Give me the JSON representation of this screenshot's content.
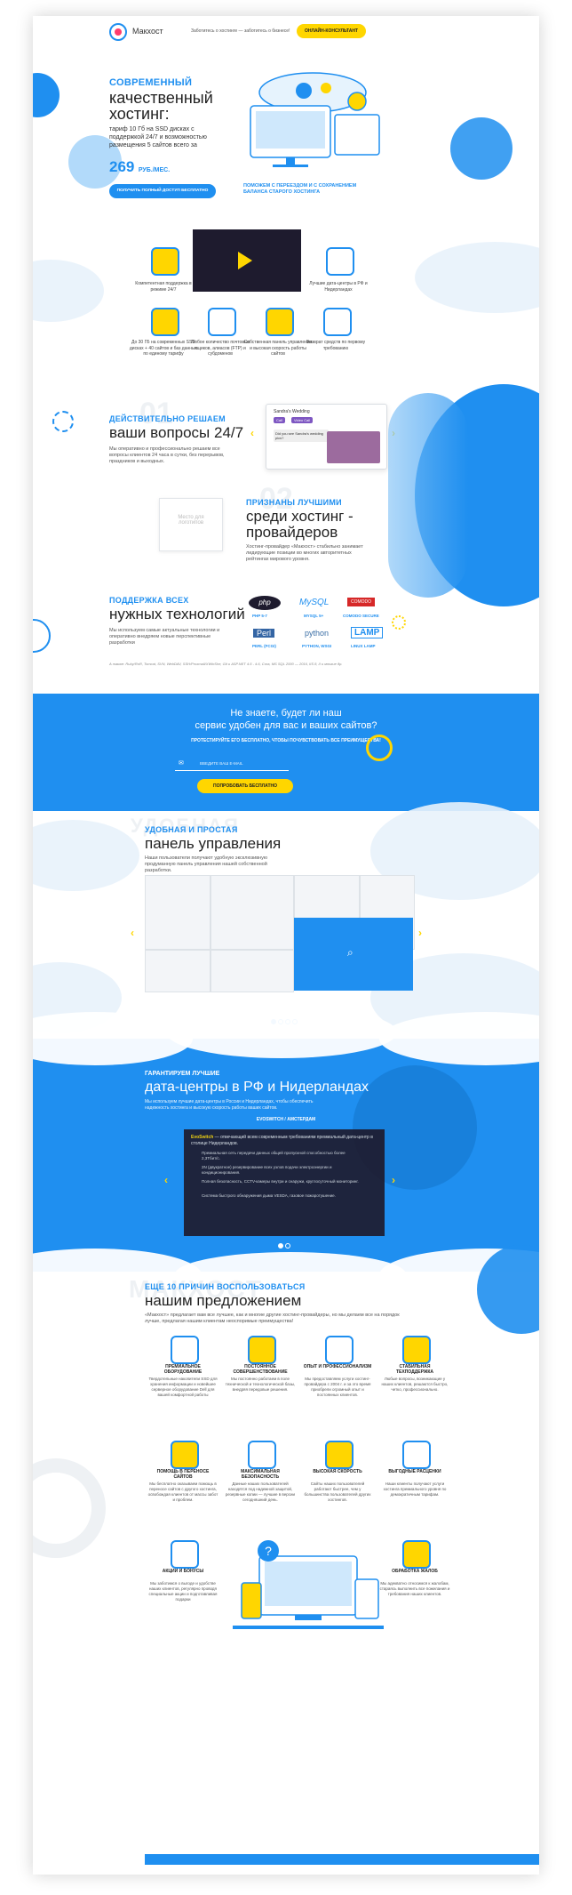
{
  "header": {
    "logo_text": "Макхост",
    "tagline": "Заботитесь о хостинге — заботитесь о бизнесе!",
    "consultant_button": "ОНЛАЙН-КОНСУЛЬТАНТ"
  },
  "hero": {
    "line1": "СОВРЕМЕННЫЙ",
    "line2": "качественный",
    "line3": "хостинг:",
    "desc": "тариф 10 Гб на SSD дисках с поддержкой 24/7 и возможностью размещения 5 сайтов всего за",
    "price": "269",
    "price_unit": "РУБ./МЕС.",
    "cta_button": "ПОЛУЧИТЬ ПОЛНЫЙ ДОСТУП БЕСПЛАТНО",
    "note": "ПОМОЖЕМ С ПЕРЕЕЗДОМ И С СОХРАНЕНИЕМ БАЛАНСА СТАРОГО ХОСТИНГА"
  },
  "features": [
    {
      "icon": "chat-support-icon",
      "text": "Компетентная поддержка в режиме 24/7"
    },
    {
      "icon": "datacenter-icon",
      "text": "Лучшие дата-центры в РФ и Нидерландах"
    },
    {
      "icon": "ssd-disk-icon",
      "text": "До 30 ГБ на современных SSD дисках + 40 сайтов и баз данных по единому тарифу"
    },
    {
      "icon": "mail-icon",
      "text": "Любое количество почтовых ящиков, алиасов (FTP) и субдоменов"
    },
    {
      "icon": "panel-icon",
      "text": "Собственная панель управления и высокая скорость работы сайтов"
    },
    {
      "icon": "money-back-icon",
      "text": "Возврат средств по первому требованию"
    }
  ],
  "solve": {
    "small": "ДЕЙСТВИТЕЛЬНО РЕШАЕМ",
    "big": "ваши вопросы 24/7",
    "bg_number": "01",
    "desc": "Мы оперативно и профессионально решаем все вопросы клиентов 24 часа в сутки, без перерывов, праздников и выходных.",
    "chat_name": "Sandra's Wedding",
    "chat_call": "Call",
    "chat_video": "Video Call",
    "chat_msg": "Did you see Sandra's wedding pics?"
  },
  "best": {
    "small": "ПРИЗНАНЫ ЛУЧШИМИ",
    "big1": "среди хостинг -",
    "big2": "провайдеров",
    "bg_number": "02",
    "logo_placeholder": "Место для логотипов",
    "desc": "Хостинг-провайдер «Макхост» стабильно занимает лидирующие позиции во многих авторитетных рейтингах мирового уровня."
  },
  "tech": {
    "small": "ПОДДЕРЖКА ВСЕХ",
    "big": "нужных технологий",
    "desc": "Мы используем самые актуальные технологии и оперативно внедряем новые перспективные разработки",
    "items": [
      {
        "logo": "php",
        "label": "PHP 5-7"
      },
      {
        "logo": "MySQL",
        "label": "MYSQL 5+"
      },
      {
        "logo": "COMODO",
        "label": "COMODO SECURE"
      },
      {
        "logo": "Perl",
        "label": "PERL (FCGI)"
      },
      {
        "logo": "python",
        "label": "PYTHON, WSGI"
      },
      {
        "logo": "LAMP",
        "label": "LINUX LAMP"
      }
    ],
    "footnote": "А также: Ruby/RoR, Tomcat, SVN, WebDAV, SSH/Proxmail/XWinShe, Git и ASP.NET 4.5 - 4.6, Cora, MS SQL 2000 — 2016, IIS 8, II и многие др."
  },
  "trial": {
    "title1": "Не знаете, будет ли наш",
    "title2": "сервис удобен для вас и ваших сайтов?",
    "subtitle": "ПРОТЕСТИРУЙТЕ ЕГО БЕСПЛАТНО, ЧТОБЫ ПОЧУВСТВОВАТЬ ВСЕ ПРЕИМУЩЕСТВА!",
    "email_placeholder": "ВВЕДИТЕ ВАШ E-MAIL",
    "button": "ПОПРОБОВАТЬ БЕСПЛАТНО"
  },
  "panel": {
    "bg_word": "УДОБНАЯ",
    "small": "УДОБНАЯ И ПРОСТАЯ",
    "big": "панель управления",
    "desc": "Наши пользователи получают удобную эксклюзивную продуманную панель управления нашей собственной разработки.",
    "dots": [
      "active",
      "",
      "",
      ""
    ]
  },
  "datacenters": {
    "small": "ГАРАНТИРУЕМ ЛУЧШИЕ",
    "big": "дата-центры в РФ и Нидерландах",
    "desc": "Мы используем лучшие дата-центры в России и Нидерландах, чтобы обеспечить надежность хостинга и высокую скорость работы ваших сайтов.",
    "tabs": "EVOSWITCH / АМСТЕРДАМ",
    "card_title": "EvoSwitch",
    "card_text": " — отвечающий всем современным требованиям премиальный дата-центр в столице Нидерландов.",
    "bullets": [
      "Премиальная сеть передачи данных общей пропускной способностью более 2,3Тбит/с.",
      "2N (двукратное) резервирование всех узлов подачи электроэнергии и кондиционирования.",
      "Полная безопасность, CCTV-камеры внутри и снаружи, круглосуточный мониторинг.",
      "Система быстрого обнаружения дыма VESDA, газовое пожаротушение."
    ]
  },
  "reasons": {
    "bg_word": "МАКХОСТ",
    "small": "ЕЩЕ 10 ПРИЧИН ВОСПОЛЬЗОВАТЬСЯ",
    "big": "нашим предложением",
    "desc": "«Макхост» предлагает вам все лучшее, как и многие другие хостинг-провайдеры, но мы делаем все на порядок лучше, предлагая нашим клиентам неоспоримые преимущества!",
    "items": [
      {
        "title": "ПРЕМИАЛЬНОЕ ОБОРУДОВАНИЕ",
        "text": "Твердотельные накопители SSD для хранения информации и новейшее серверное оборудование Dell для вашей комфортной работы",
        "icon": "server-icon"
      },
      {
        "title": "ПОСТОЯННОЕ СОВЕРШЕНСТВОВАНИЕ",
        "text": "Мы постоянно работаем в поле технической и технологической базы, внедряя передовые решения.",
        "icon": "gear-icon"
      },
      {
        "title": "ОПЫТ И ПРОФЕССИОНАЛИЗМ",
        "text": "Мы предоставляем услуги хостинг-провайдера с 2004 г. и за это время приобрели огромный опыт и постоянных клиентов.",
        "icon": "star-icon"
      },
      {
        "title": "СТАБИЛЬНАЯ ТЕХПОДДЕРЖКА",
        "text": "Любые вопросы, возникающие у наших клиентов, решаются быстро, четко, профессионально.",
        "icon": "wrench-icon"
      },
      {
        "title": "ПОМОЩЬ В ПЕРЕНОСЕ САЙТОВ",
        "text": "Мы бесплатно оказываем помощь в переносе сайтов с другого хостинга, освобождая клиентов от массы забот и проблем.",
        "icon": "transfer-icon"
      },
      {
        "title": "МАКСИМАЛЬНАЯ БЕЗОПАСНОСТЬ",
        "text": "Данные наших пользователей находятся под надежной защитой, резервные копии — лучшие в версии сегодняшний день.",
        "icon": "shield-icon"
      },
      {
        "title": "ВЫСОКАЯ СКОРОСТЬ",
        "text": "Сайты наших пользователей работают быстрее, чем у большинства пользователей других хостингов.",
        "icon": "speed-icon"
      },
      {
        "title": "ВЫГОДНЫЕ РАСЦЕНКИ",
        "text": "Наши клиенты получают услуги хостинга премиального уровня по демократичным тарифам.",
        "icon": "wallet-icon"
      },
      {
        "title": "АКЦИИ И БОНУСЫ",
        "text": "Мы заботимся о выгоде и удобстве наших клиентов, регулярно проводя специальные акции и подготавливая подарки",
        "icon": "gift-icon"
      },
      {
        "title": "ОБРАБОТКА ЖАЛОБ",
        "text": "Мы адекватно относимся к жалобам, стараясь выполнить все пожелания и требования наших клиентов.",
        "icon": "complaint-icon"
      }
    ]
  },
  "colors": {
    "accent": "#1f8ff0",
    "yellow": "#ffd600",
    "dark": "#1e1b2e"
  }
}
